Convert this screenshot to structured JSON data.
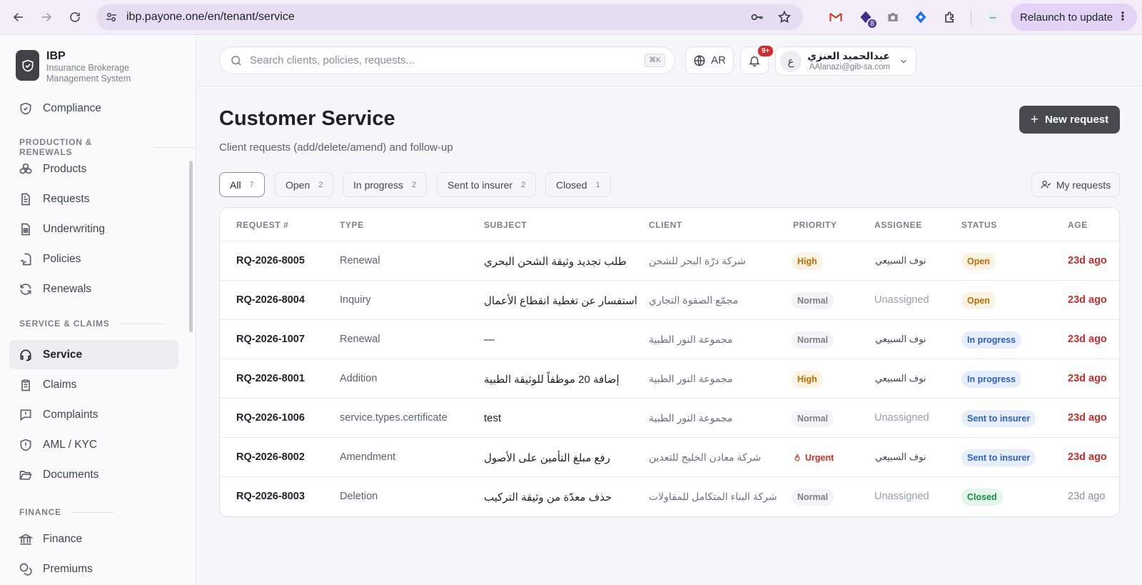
{
  "browser": {
    "url": "ibp.payone.one/en/tenant/service",
    "ext_badge": "8",
    "relaunch": "Relaunch to update"
  },
  "brand": {
    "name": "IBP",
    "subtitle": "Insurance Brokerage Management System"
  },
  "sidebar": {
    "top_item": "Compliance",
    "sections": [
      {
        "title": "PRODUCTION & RENEWALS",
        "items": [
          "Products",
          "Requests",
          "Underwriting",
          "Policies",
          "Renewals"
        ]
      },
      {
        "title": "SERVICE & CLAIMS",
        "items": [
          "Service",
          "Claims",
          "Complaints",
          "AML / KYC",
          "Documents"
        ]
      },
      {
        "title": "FINANCE",
        "items": [
          "Finance",
          "Premiums"
        ]
      }
    ],
    "active": "Service"
  },
  "topbar": {
    "search_placeholder": "Search clients, policies, requests...",
    "search_kbd": "⌘K",
    "lang": "AR",
    "notifications": "9+",
    "user": {
      "initial": "ع",
      "name": "عبدالحميد العنزي",
      "email": "AAlanazi@gib-sa.com"
    }
  },
  "page": {
    "title": "Customer Service",
    "subtitle": "Client requests (add/delete/amend) and follow-up",
    "new_button": "New request",
    "my_requests": "My requests"
  },
  "tabs": [
    {
      "label": "All",
      "count": "7"
    },
    {
      "label": "Open",
      "count": "2"
    },
    {
      "label": "In progress",
      "count": "2"
    },
    {
      "label": "Sent to insurer",
      "count": "2"
    },
    {
      "label": "Closed",
      "count": "1"
    }
  ],
  "table": {
    "columns": [
      "REQUEST #",
      "TYPE",
      "SUBJECT",
      "CLIENT",
      "PRIORITY",
      "ASSIGNEE",
      "STATUS",
      "AGE"
    ],
    "rows": [
      {
        "id": "RQ-2026-8005",
        "type": "Renewal",
        "subject": "طلب تجديد وثيقة الشحن البحري",
        "client": "شركة درّة البحر للشحن",
        "priority": "High",
        "assignee": "نوف السبيعي",
        "status": "Open",
        "age": "23d ago"
      },
      {
        "id": "RQ-2026-8004",
        "type": "Inquiry",
        "subject": "استفسار عن تغطية انقطاع الأعمال",
        "client": "مجمّع الصفوة التجاري",
        "priority": "Normal",
        "assignee": "Unassigned",
        "status": "Open",
        "age": "23d ago"
      },
      {
        "id": "RQ-2026-1007",
        "type": "Renewal",
        "subject": "—",
        "client": "مجموعة النور الطبية",
        "priority": "Normal",
        "assignee": "نوف السبيعي",
        "status": "In progress",
        "age": "23d ago"
      },
      {
        "id": "RQ-2026-8001",
        "type": "Addition",
        "subject": "إضافة 20 موظفاً للوثيقة الطبية",
        "client": "مجموعة النور الطبية",
        "priority": "High",
        "assignee": "نوف السبيعي",
        "status": "In progress",
        "age": "23d ago"
      },
      {
        "id": "RQ-2026-1006",
        "type": "service.types.certificate",
        "subject": "test",
        "client": "مجموعة النور الطبية",
        "priority": "Normal",
        "assignee": "Unassigned",
        "status": "Sent to insurer",
        "age": "23d ago"
      },
      {
        "id": "RQ-2026-8002",
        "type": "Amendment",
        "subject": "رفع مبلغ التأمين على الأصول",
        "client": "شركة معادن الخليج للتعدين",
        "priority": "Urgent",
        "assignee": "نوف السبيعي",
        "status": "Sent to insurer",
        "age": "23d ago"
      },
      {
        "id": "RQ-2026-8003",
        "type": "Deletion",
        "subject": "حذف معدّة من وثيقة التركيب",
        "client": "شركة البناء المتكامل للمقاولات",
        "priority": "Normal",
        "assignee": "Unassigned",
        "status": "Closed",
        "age": "23d ago"
      }
    ]
  }
}
